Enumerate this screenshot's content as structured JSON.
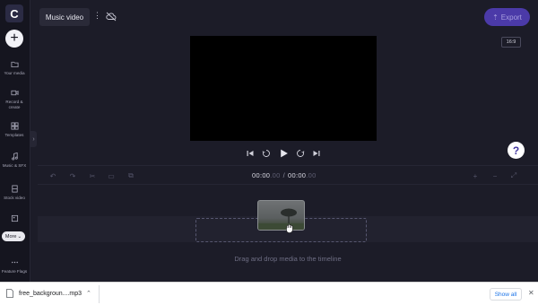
{
  "app": {
    "logo_letter": "C",
    "project_title": "Music video"
  },
  "header": {
    "export_label": "Export",
    "aspect_ratio": "16:9"
  },
  "sidebar": {
    "items": [
      {
        "label": "Your media",
        "icon": "folder-icon"
      },
      {
        "label": "Record & create",
        "icon": "camera-icon"
      },
      {
        "label": "Templates",
        "icon": "templates-icon"
      },
      {
        "label": "Music & SFX",
        "icon": "music-note-icon"
      },
      {
        "label": "Stock video",
        "icon": "film-icon"
      },
      {
        "label": "Feature Flags",
        "icon": "dots-icon"
      }
    ],
    "more_label": "More"
  },
  "timeline": {
    "timecode_current": "00:00",
    "timecode_current_frames": ".00",
    "timecode_total": "00:00",
    "timecode_total_frames": ".00",
    "drop_hint": "Drag and drop media to the timeline"
  },
  "help": {
    "label": "?"
  },
  "download_bar": {
    "file_name": "free_backgroun....mp3",
    "show_all_label": "Show all"
  },
  "colors": {
    "background": "#1c1c28",
    "sidebar": "#15151f",
    "accent": "#4b3aa8",
    "link": "#1a73e8"
  }
}
